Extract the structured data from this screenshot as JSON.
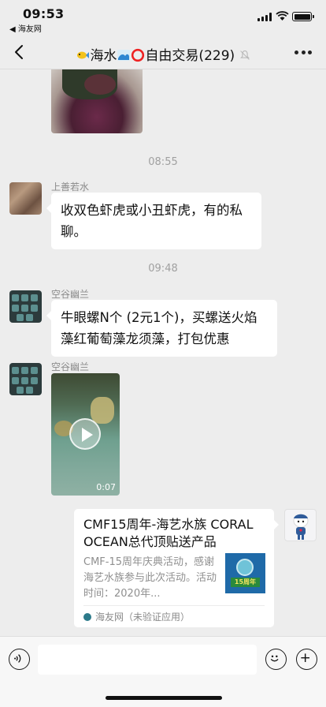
{
  "status_bar": {
    "time": "09:53",
    "back_app": "◀ 海友网"
  },
  "nav": {
    "title_prefix": "海水",
    "title_main": "自由交易(229)"
  },
  "messages": {
    "ts1": "08:55",
    "msg1": {
      "name": "上善若水",
      "text": "收双色虾虎或小丑虾虎，有的私聊。"
    },
    "ts2": "09:48",
    "msg2": {
      "name": "空谷幽兰",
      "text": "牛眼螺N个 (2元1个)，买螺送火焰藻红葡萄藻龙须藻，打包优惠"
    },
    "msg3": {
      "name": "空谷幽兰",
      "video_duration": "0:07"
    },
    "card": {
      "title": "CMF15周年-海艺水族 CORAL OCEAN总代顶贴送产品",
      "desc": "CMF-15周年庆典活动，感谢海艺水族参与此次活动。活动时间：2020年...",
      "thumb_tag": "15周年",
      "source": "海友网（未验证应用）"
    }
  },
  "icons": [
    "back-icon",
    "mute-icon",
    "more-icon",
    "play-icon",
    "voice-icon",
    "emoji-icon",
    "add-icon"
  ]
}
